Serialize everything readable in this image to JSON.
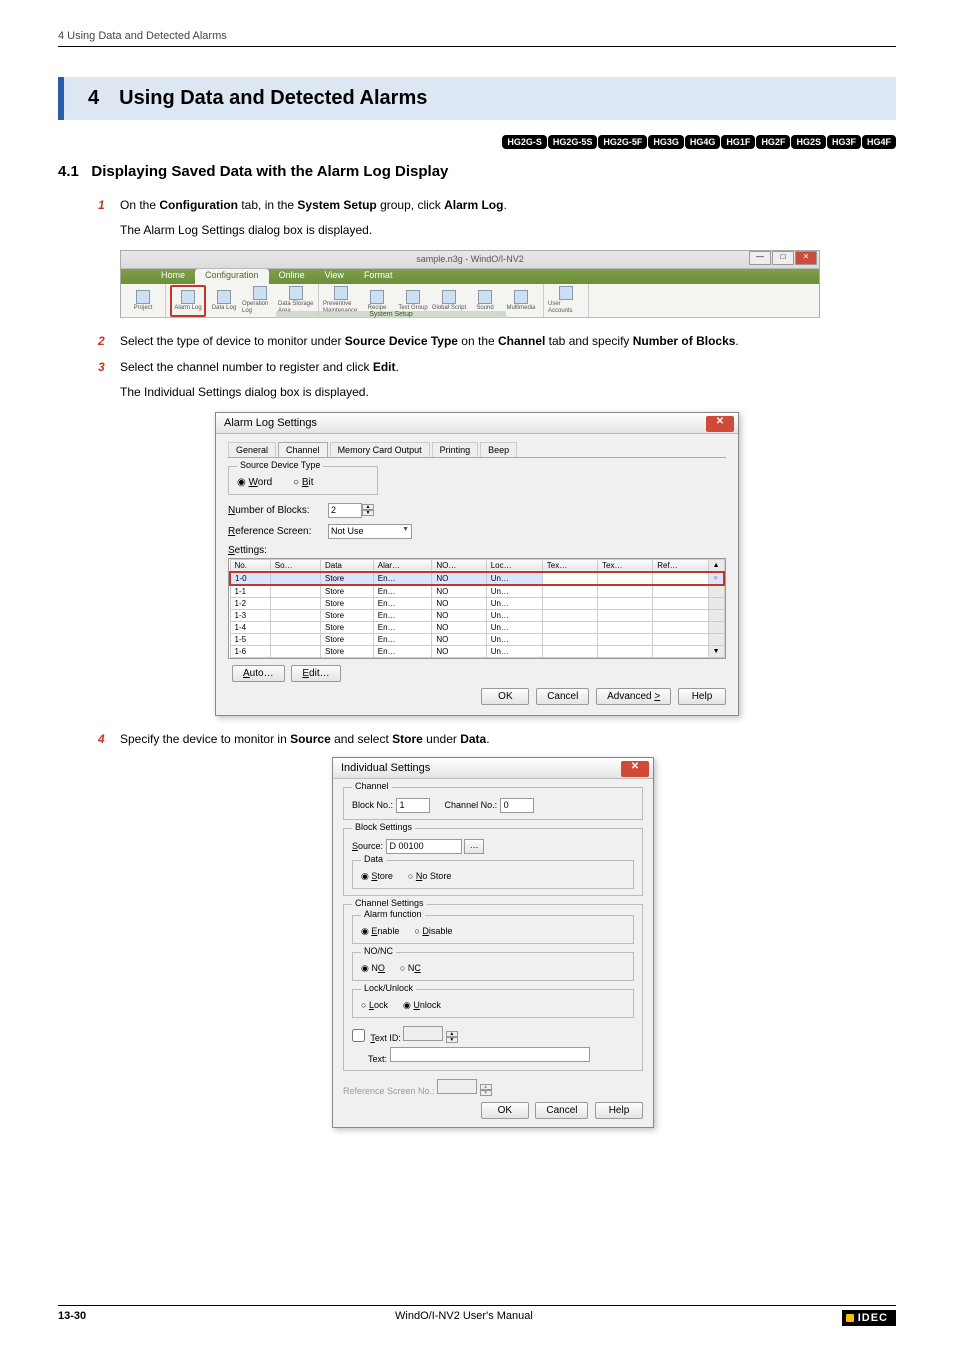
{
  "running_header": "4 Using Data and Detected Alarms",
  "chapter": {
    "num": "4",
    "title": "Using Data and Detected Alarms"
  },
  "badges": [
    "HG2G-S",
    "HG2G-5S",
    "HG2G-5F",
    "HG3G",
    "HG4G",
    "HG1F",
    "HG2F",
    "HG2S",
    "HG3F",
    "HG4F"
  ],
  "section": {
    "num": "4.1",
    "title": "Displaying Saved Data with the Alarm Log Display"
  },
  "steps": {
    "s1": {
      "num": "1",
      "body_a": "On the ",
      "body_b": "Configuration",
      "body_c": " tab, in the ",
      "body_d": "System Setup",
      "body_e": " group, click ",
      "body_f": "Alarm Log",
      "body_g": ".",
      "note": "The Alarm Log Settings dialog box is displayed."
    },
    "s2": {
      "num": "2",
      "body_a": "Select the type of device to monitor under ",
      "body_b": "Source Device Type",
      "body_c": " on the ",
      "body_d": "Channel",
      "body_e": " tab and specify ",
      "body_f": "Number of Blocks",
      "body_g": "."
    },
    "s3": {
      "num": "3",
      "body_a": "Select the channel number to register and click ",
      "body_b": "Edit",
      "body_c": ".",
      "note": "The Individual Settings dialog box is displayed."
    },
    "s4": {
      "num": "4",
      "body_a": "Specify the device to monitor in ",
      "body_b": "Source",
      "body_c": " and select ",
      "body_d": "Store",
      "body_e": " under ",
      "body_f": "Data",
      "body_g": "."
    }
  },
  "ribbon": {
    "title": "sample.n3g - WindO/I-NV2",
    "tabs": [
      "Home",
      "Configuration",
      "Online",
      "View",
      "Format"
    ],
    "active_tab": "Configuration",
    "buttons": [
      {
        "label": "Project"
      },
      {
        "label": "Alarm Log",
        "hl": true
      },
      {
        "label": "Data Log"
      },
      {
        "label": "Operation Log"
      },
      {
        "label": "Data Storage Area"
      },
      {
        "label": "Preventive Maintenance"
      },
      {
        "label": "Recipe"
      },
      {
        "label": "Text Group"
      },
      {
        "label": "Global Script"
      },
      {
        "label": "Sound"
      },
      {
        "label": "Multimedia"
      },
      {
        "label": "User Accounts"
      }
    ],
    "group_label": "System Setup"
  },
  "dlg1": {
    "title": "Alarm Log Settings",
    "tabs": [
      "General",
      "Channel",
      "Memory Card Output",
      "Printing",
      "Beep"
    ],
    "active_tab": "Channel",
    "sdt_legend": "Source Device Type",
    "sdt_word": "Word",
    "sdt_bit": "Bit",
    "numblocks_label": "Number of Blocks:",
    "numblocks_value": "2",
    "refscreen_label": "Reference Screen:",
    "refscreen_value": "Not Use",
    "settings_label": "Settings:",
    "grid_headers": [
      "No.",
      "So…",
      "Data",
      "Alar…",
      "NO…",
      "Loc…",
      "Tex…",
      "Tex…",
      "Ref…"
    ],
    "rows": [
      {
        "no": "1-0",
        "so": "",
        "data": "Store",
        "alar": "En…",
        "noc": "NO",
        "loc": "Un…",
        "t1": "",
        "t2": "",
        "ref": "",
        "hl": true
      },
      {
        "no": "1-1",
        "so": "",
        "data": "Store",
        "alar": "En…",
        "noc": "NO",
        "loc": "Un…",
        "t1": "",
        "t2": "",
        "ref": ""
      },
      {
        "no": "1-2",
        "so": "",
        "data": "Store",
        "alar": "En…",
        "noc": "NO",
        "loc": "Un…",
        "t1": "",
        "t2": "",
        "ref": ""
      },
      {
        "no": "1-3",
        "so": "",
        "data": "Store",
        "alar": "En…",
        "noc": "NO",
        "loc": "Un…",
        "t1": "",
        "t2": "",
        "ref": ""
      },
      {
        "no": "1-4",
        "so": "",
        "data": "Store",
        "alar": "En…",
        "noc": "NO",
        "loc": "Un…",
        "t1": "",
        "t2": "",
        "ref": ""
      },
      {
        "no": "1-5",
        "so": "",
        "data": "Store",
        "alar": "En…",
        "noc": "NO",
        "loc": "Un…",
        "t1": "",
        "t2": "",
        "ref": ""
      },
      {
        "no": "1-6",
        "so": "",
        "data": "Store",
        "alar": "En…",
        "noc": "NO",
        "loc": "Un…",
        "t1": "",
        "t2": "",
        "ref": ""
      }
    ],
    "auto_btn": "Auto…",
    "edit_btn": "Edit…",
    "ok_btn": "OK",
    "cancel_btn": "Cancel",
    "adv_btn": "Advanced >",
    "help_btn": "Help"
  },
  "dlg2": {
    "title": "Individual Settings",
    "channel_legend": "Channel",
    "block_label": "Block No.:",
    "block_value": "1",
    "channo_label": "Channel No.:",
    "channo_value": "0",
    "blockset_legend": "Block Settings",
    "source_label": "Source:",
    "source_value": "D 00100",
    "data_legend": "Data",
    "store": "Store",
    "nostore": "No Store",
    "chanset_legend": "Channel Settings",
    "alarmfn_legend": "Alarm function",
    "enable": "Enable",
    "disable": "Disable",
    "nonc_legend": "NO/NC",
    "no": "NO",
    "nc": "NC",
    "lock_legend": "Lock/Unlock",
    "lock": "Lock",
    "unlock": "Unlock",
    "textid_label": "Text ID:",
    "text_label": "Text:",
    "refscr_label": "Reference Screen No.:",
    "ok": "OK",
    "cancel": "Cancel",
    "help": "Help"
  },
  "footer": {
    "page": "13-30",
    "manual": "WindO/I-NV2 User's Manual",
    "brand": "IDEC"
  }
}
